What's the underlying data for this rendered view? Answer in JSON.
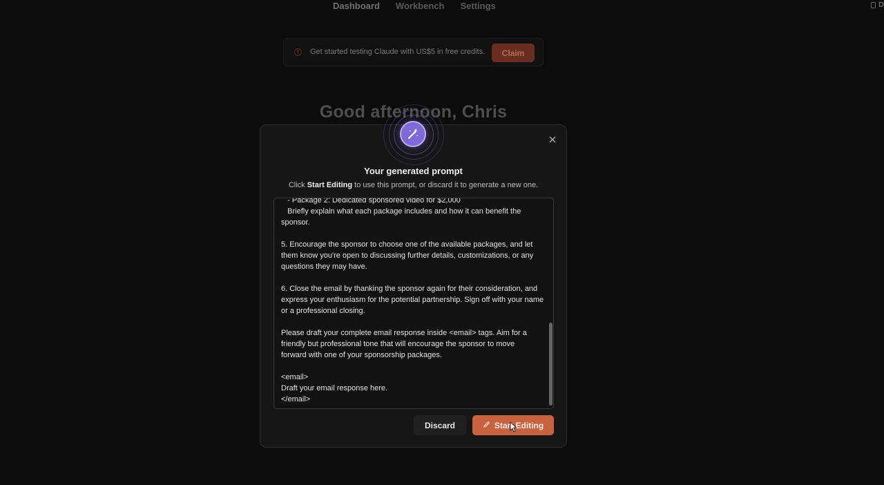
{
  "nav": {
    "tabs": [
      {
        "label": "Dashboard",
        "active": true
      },
      {
        "label": "Workbench",
        "active": false
      },
      {
        "label": "Settings",
        "active": false
      }
    ],
    "right_label": "D"
  },
  "banner": {
    "text": "Get started testing Claude with US$5 in free credits.",
    "button_label": "Claim",
    "icon": "alert-circle-icon"
  },
  "greeting": "Good afternoon, Chris",
  "modal": {
    "icon": "magic-wand-icon",
    "title": "Your generated prompt",
    "subtitle_prefix": "Click ",
    "subtitle_bold": "Start Editing",
    "subtitle_suffix": " to use this prompt, or discard it to generate a new one.",
    "prompt_lines": [
      "   - Package 2: Dedicated sponsored video for $2,000",
      "   Briefly explain what each package includes and how it can benefit the",
      "sponsor.",
      "",
      "5. Encourage the sponsor to choose one of the available packages, and let",
      "them know you're open to discussing further details, customizations, or any",
      "questions they may have.",
      "",
      "6. Close the email by thanking the sponsor again for their consideration, and",
      "express your enthusiasm for the potential partnership. Sign off with your name",
      "or a professional closing.",
      "",
      "Please draft your complete email response inside <email> tags. Aim for a",
      "friendly but professional tone that will encourage the sponsor to move",
      "forward with one of your sponsorship packages.",
      "",
      "<email>",
      "Draft your email response here.",
      "</email>"
    ],
    "discard_label": "Discard",
    "start_label": "Start Editing",
    "start_icon": "pencil-icon",
    "close_icon": "close-icon"
  },
  "colors": {
    "accent": "#c9633f",
    "badge": "#7d6ad8",
    "background": "#0c0c0c",
    "modal": "#161616"
  }
}
